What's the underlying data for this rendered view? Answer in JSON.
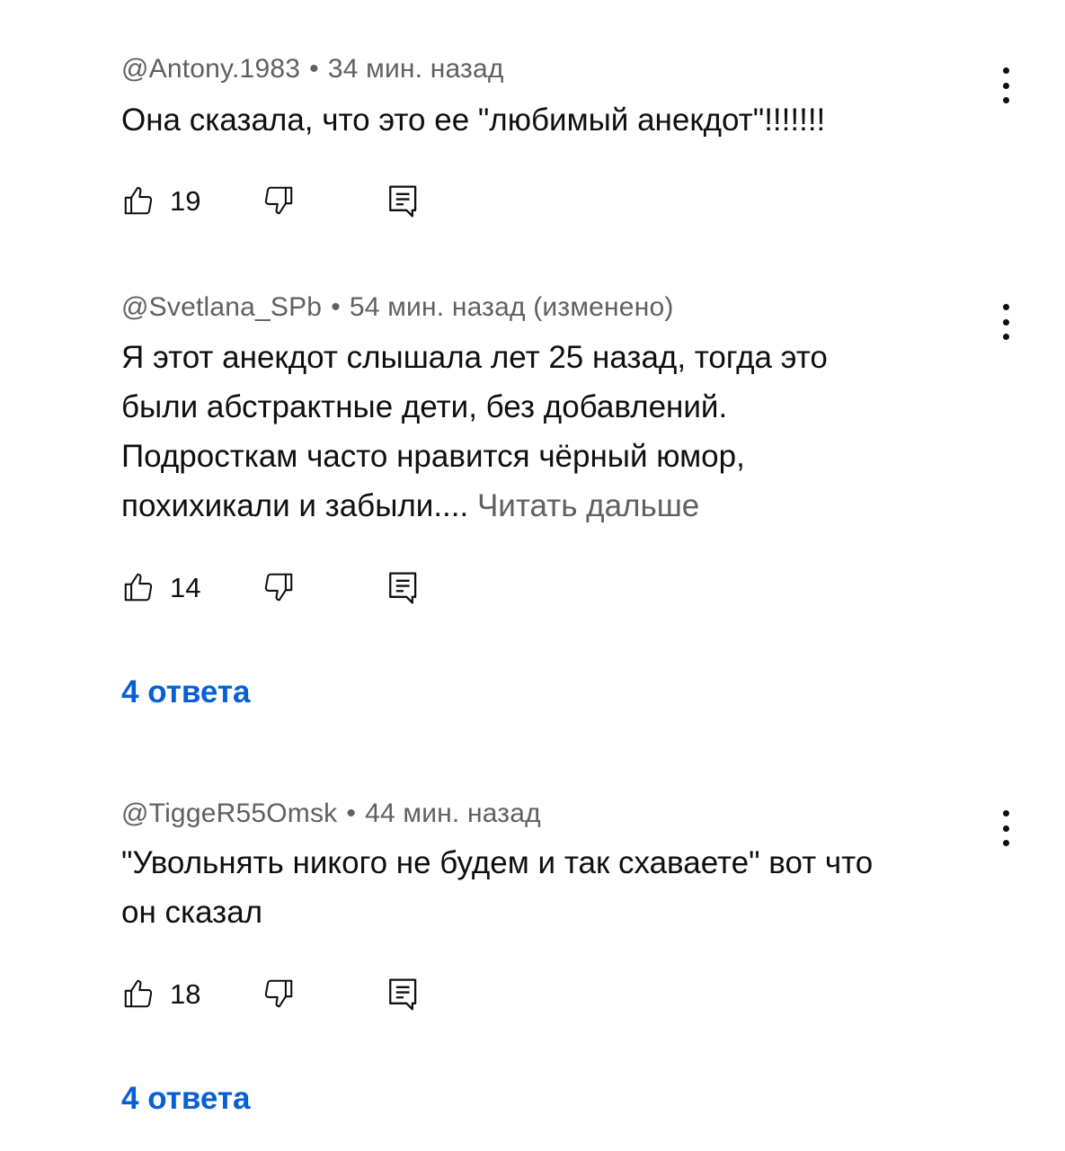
{
  "comments": [
    {
      "author": "@Antony.1983",
      "separator": "•",
      "time": "34 мин. назад",
      "text_lines": [
        "Она сказала, что это ее \"любимый анекдот\"!!!!!!!"
      ],
      "likes": "19"
    },
    {
      "author": "@Svetlana_SPb",
      "separator": "•",
      "time": "54 мин. назад (изменено)",
      "text_lines": [
        "Я этот анекдот слышала лет 25 назад, тогда это",
        "были абстрактные дети, без добавлений.",
        "Подросткам часто нравится чёрный юмор,",
        "похихикали и забыли...."
      ],
      "read_more": "Читать дальше",
      "likes": "14",
      "replies_label": "4 ответа"
    },
    {
      "author": "@TiggeR55Omsk",
      "separator": "•",
      "time": "44 мин. назад",
      "text_lines": [
        "\"Увольнять никого не будем и так схаваете\" вот что",
        "он сказал"
      ],
      "likes": "18",
      "replies_label": "4 ответа"
    }
  ],
  "icons": {
    "like": "thumb-up-icon",
    "dislike": "thumb-down-icon",
    "reply": "comment-reply-icon",
    "menu": "more-vertical-icon"
  },
  "colors": {
    "text": "#0f0f0f",
    "meta": "#606060",
    "link": "#065fd4"
  }
}
